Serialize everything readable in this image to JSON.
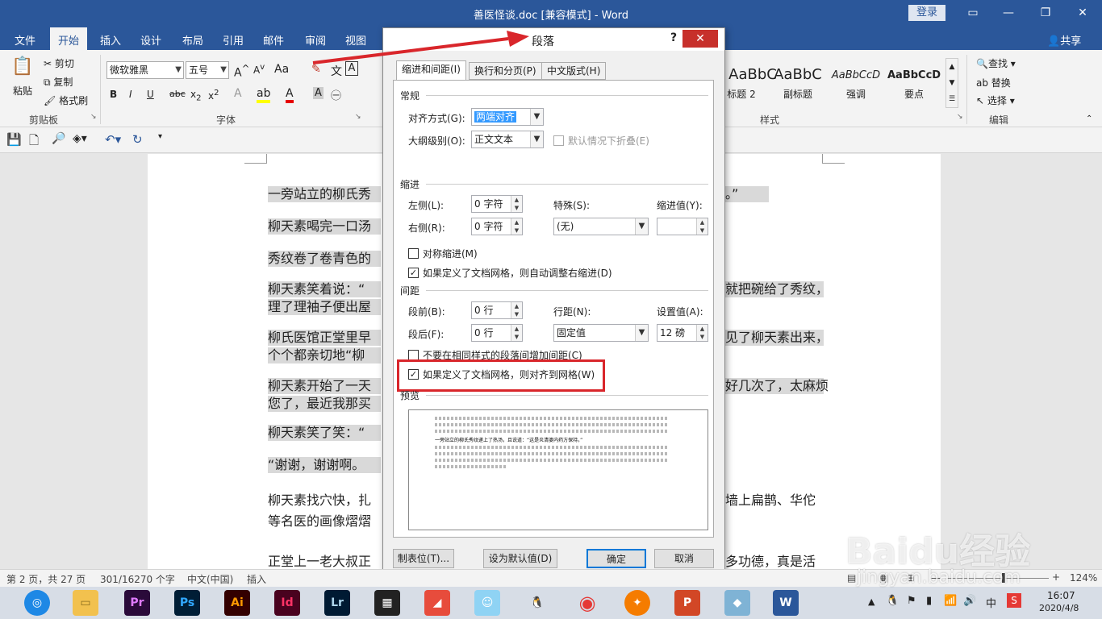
{
  "window": {
    "title": "善医怪谈.doc [兼容模式] - Word",
    "login": "登录"
  },
  "tabs": [
    "文件",
    "开始",
    "插入",
    "设计",
    "布局",
    "引用",
    "邮件",
    "审阅",
    "视图"
  ],
  "share": "共享",
  "clipboard": {
    "paste": "粘贴",
    "cut": "剪切",
    "copy": "复制",
    "format_painter": "格式刷",
    "group": "剪贴板"
  },
  "font": {
    "name": "微软雅黑",
    "size": "五号",
    "group": "字体",
    "aa": "Aa"
  },
  "styles": {
    "items": [
      {
        "preview": "AaBbC",
        "label": "标题 2"
      },
      {
        "preview": "AaBbC",
        "label": "副标题"
      },
      {
        "preview": "AaBbCcD",
        "label": "强调"
      },
      {
        "preview": "AaBbCcD",
        "label": "要点"
      }
    ],
    "group": "样式"
  },
  "editing": {
    "find": "查找",
    "replace": "替换",
    "select": "选择",
    "group": "编辑"
  },
  "document": {
    "paragraphs": [
      {
        "left": "一旁站立的柳氏秀",
        "right": "。”"
      },
      {
        "left": "柳天素喝完一口汤",
        "right": ""
      },
      {
        "left": "秀纹卷了卷青色的",
        "right": ""
      },
      {
        "left": "柳天素笑着说：“",
        "right": "就把碗给了秀纹，"
      },
      {
        "left": "理了理袖子便出屋",
        "right": ""
      },
      {
        "left": "柳氏医馆正堂里早",
        "right": "见了柳天素出来，"
      },
      {
        "left": "个个都亲切地“柳",
        "right": ""
      },
      {
        "left": "柳天素开始了一天",
        "right": "好几次了，太麻烦"
      },
      {
        "left": "您了，最近我那买",
        "right": ""
      },
      {
        "left": "柳天素笑了笑：“",
        "right": ""
      },
      {
        "left": "“谢谢，谢谢啊。",
        "right": ""
      },
      {
        "left": "柳天素找穴快，扎",
        "right": "墙上扁鹊、华佗"
      },
      {
        "left": "等名医的画像熠熠",
        "right": ""
      },
      {
        "left": "正堂上一老大叔正",
        "right": "多功德，真是活"
      }
    ]
  },
  "dialog": {
    "title": "段落",
    "help": "?",
    "tabs": [
      "缩进和间距(I)",
      "换行和分页(P)",
      "中文版式(H)"
    ],
    "general": {
      "heading": "常规",
      "align_label": "对齐方式(G):",
      "align_value": "两端对齐",
      "outline_label": "大纲级别(O):",
      "outline_value": "正文文本",
      "collapse_label": "默认情况下折叠(E)"
    },
    "indent": {
      "heading": "缩进",
      "left_label": "左侧(L):",
      "left_value": "0 字符",
      "right_label": "右侧(R):",
      "right_value": "0 字符",
      "special_label": "特殊(S):",
      "special_value": "(无)",
      "by_label": "缩进值(Y):",
      "by_value": "",
      "mirror_label": "对称缩进(M)",
      "auto_adjust_label": "如果定义了文档网格，则自动调整右缩进(D)"
    },
    "spacing": {
      "heading": "间距",
      "before_label": "段前(B):",
      "before_value": "0 行",
      "after_label": "段后(F):",
      "after_value": "0 行",
      "line_label": "行距(N):",
      "line_value": "固定值",
      "at_label": "设置值(A):",
      "at_value": "12 磅",
      "no_space_label": "不要在相同样式的段落间增加间距(C)",
      "snap_grid_label": "如果定义了文档网格，则对齐到网格(W)"
    },
    "preview": {
      "heading": "预览",
      "sample": "一旁站立的柳氏秀纹递上了热汤，且说道：“这是炎清婆内药方保持。”"
    },
    "buttons": {
      "tabs": "制表位(T)...",
      "default": "设为默认值(D)",
      "ok": "确定",
      "cancel": "取消"
    }
  },
  "status": {
    "page": "第 2 页，共 27 页",
    "words": "301/16270 个字",
    "lang": "中文(中国)",
    "mode": "插入",
    "zoom": "124%"
  },
  "taskbar": {
    "icons": [
      "browser-icon",
      "explorer-icon",
      "premiere-icon",
      "photoshop-icon",
      "illustrator-icon",
      "indesign-icon",
      "lightroom-icon",
      "video-icon",
      "app-icon",
      "app-icon",
      "qq-icon",
      "chrome-icon",
      "app-icon",
      "powerpoint-icon",
      "app-icon",
      "word-icon"
    ],
    "labels": {
      "pr": "Pr",
      "ps": "Ps",
      "ai": "Ai",
      "id": "Id",
      "lr": "Lr",
      "p": "P",
      "w": "W"
    },
    "tray_ime": "中",
    "clock_time": "16:07",
    "clock_date": "2020/4/8"
  },
  "watermark": {
    "brand": "Baidu经验",
    "url": "jingyan.baidu.com"
  }
}
